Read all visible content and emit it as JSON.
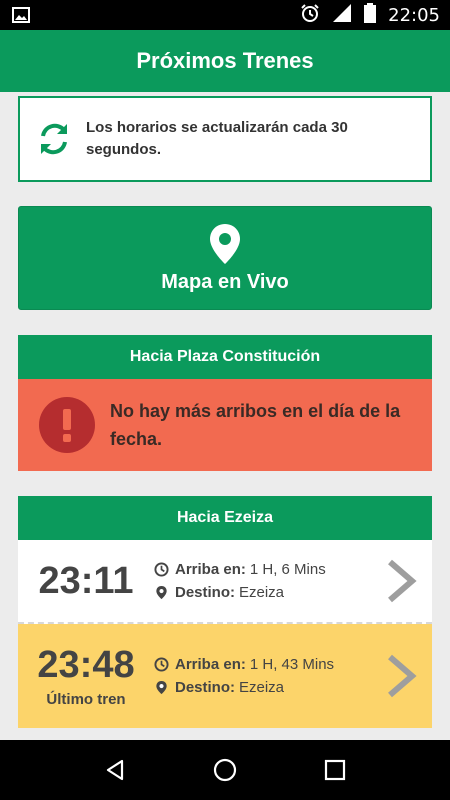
{
  "status_bar": {
    "time": "22:05"
  },
  "app_bar": {
    "title": "Próximos Trenes"
  },
  "info": {
    "message": "Los horarios se actualizarán cada 30 segundos."
  },
  "map_button": {
    "label": "Mapa en Vivo"
  },
  "sections": [
    {
      "title": "Hacia Plaza Constitución",
      "alert": "No hay más arribos en el día de la fecha."
    },
    {
      "title": "Hacia Ezeiza",
      "trains": [
        {
          "time": "23:11",
          "arrives_label": "Arriba en:",
          "arrives_value": "1 H, 6 Mins",
          "dest_label": "Destino:",
          "dest_value": "Ezeiza",
          "note": ""
        },
        {
          "time": "23:48",
          "arrives_label": "Arriba en:",
          "arrives_value": "1 H, 43 Mins",
          "dest_label": "Destino:",
          "dest_value": "Ezeiza",
          "note": "Último tren"
        }
      ]
    }
  ],
  "colors": {
    "brand": "#0b9a5c",
    "alert": "#f26a50",
    "last_train": "#fcd46a"
  }
}
